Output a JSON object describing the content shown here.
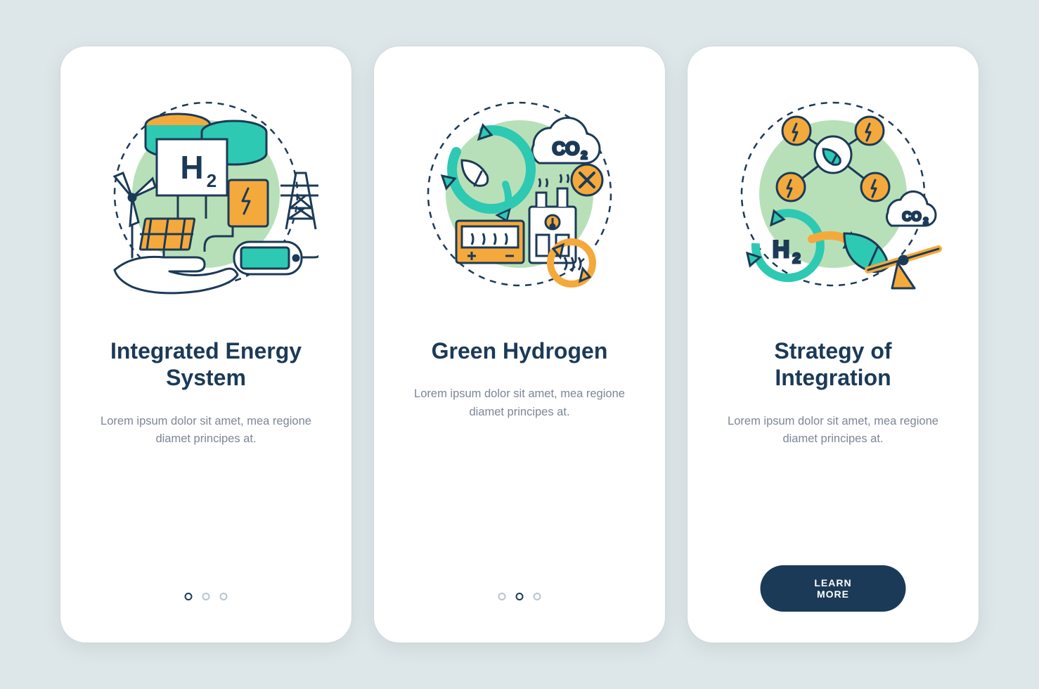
{
  "colors": {
    "bg": "#dde7e9",
    "card": "#ffffff",
    "title": "#1b3a57",
    "desc": "#7c8696",
    "accentGreen": "#b8e0b8",
    "teal": "#2dc9b2",
    "orange": "#f4a93c",
    "navy": "#1b3a57"
  },
  "screens": [
    {
      "title": "Integrated Energy System",
      "desc": "Lorem ipsum dolor sit amet, mea regione diamet principes at.",
      "activeDot": 0,
      "cta": null
    },
    {
      "title": "Green Hydrogen",
      "desc": "Lorem ipsum dolor sit amet, mea regione diamet principes at.",
      "activeDot": 1,
      "cta": null
    },
    {
      "title": "Strategy of Integration",
      "desc": "Lorem ipsum dolor sit amet, mea regione diamet principes at.",
      "activeDot": null,
      "cta": "LEARN MORE"
    }
  ]
}
